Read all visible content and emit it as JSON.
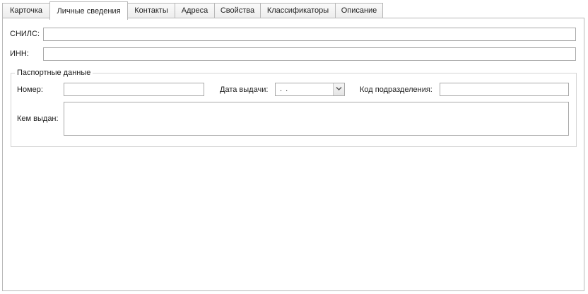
{
  "tabs": [
    {
      "label": "Карточка",
      "active": false
    },
    {
      "label": "Личные сведения",
      "active": true
    },
    {
      "label": "Контакты",
      "active": false
    },
    {
      "label": "Адреса",
      "active": false
    },
    {
      "label": "Свойства",
      "active": false
    },
    {
      "label": "Классификаторы",
      "active": false
    },
    {
      "label": "Описание",
      "active": false
    }
  ],
  "personal": {
    "snils_label": "СНИЛС:",
    "snils_value": "",
    "inn_label": "ИНН:",
    "inn_value": ""
  },
  "passport": {
    "group_title": "Паспортные данные",
    "number_label": "Номер:",
    "number_value": "",
    "issue_date_label": "Дата выдачи:",
    "issue_date_value": ". .",
    "department_code_label": "Код подразделения:",
    "department_code_value": "",
    "issued_by_label": "Кем выдан:",
    "issued_by_value": ""
  },
  "icons": {
    "date_dropdown": "chevron-down-icon"
  }
}
